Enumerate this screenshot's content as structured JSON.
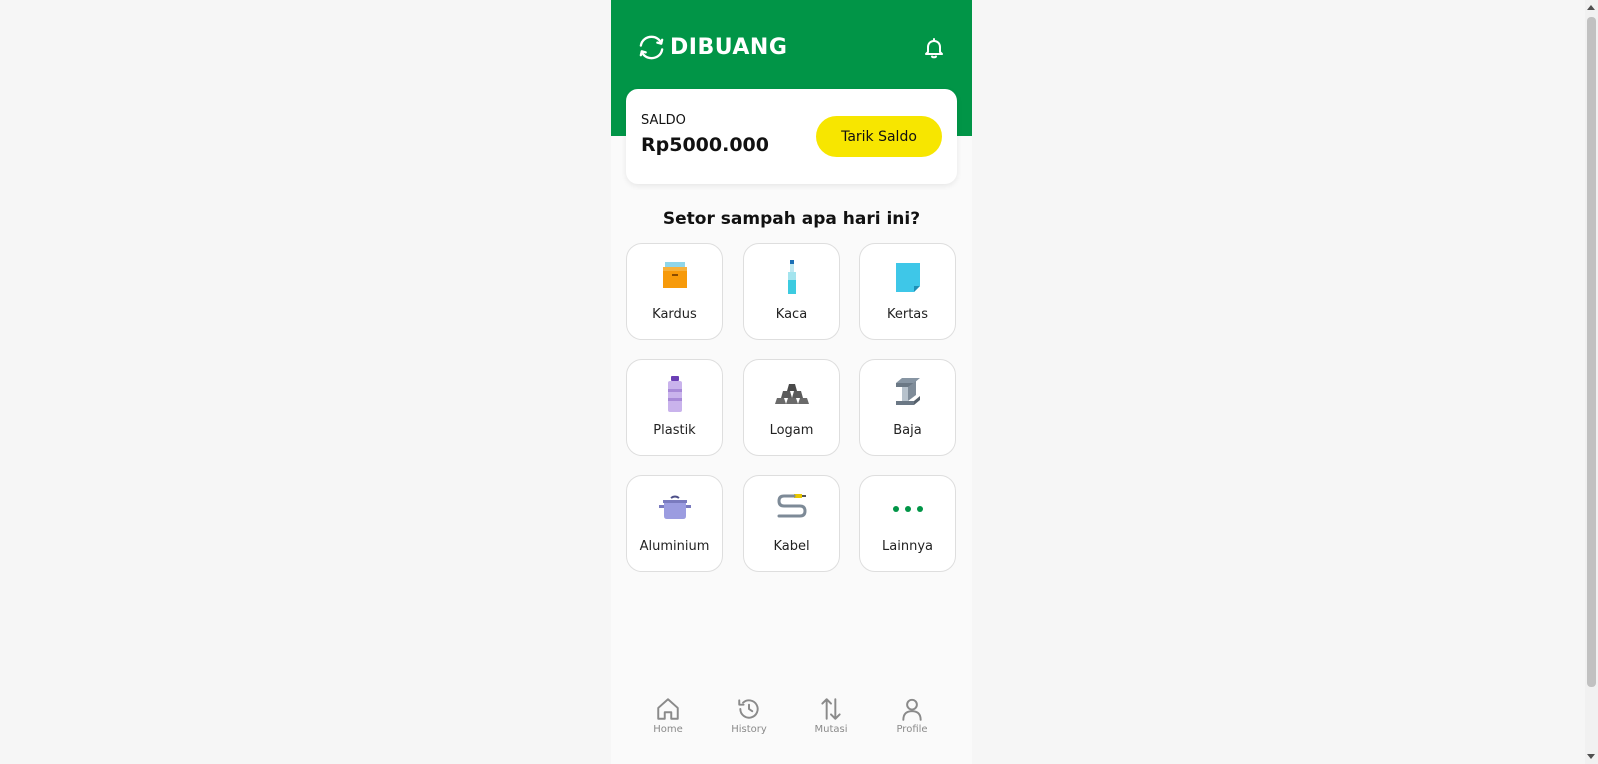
{
  "brand": {
    "name": "DIBUANG",
    "color": "#019547"
  },
  "balance": {
    "label": "SALDO",
    "amount": "Rp5000.000",
    "withdraw_label": "Tarik Saldo",
    "button_color": "#f7e600"
  },
  "deposit": {
    "title": "Setor sampah apa hari ini?",
    "categories": [
      {
        "label": "Kardus",
        "icon": "cardboard-box-icon"
      },
      {
        "label": "Kaca",
        "icon": "glass-bottle-icon"
      },
      {
        "label": "Kertas",
        "icon": "paper-icon"
      },
      {
        "label": "Plastik",
        "icon": "plastic-bottle-icon"
      },
      {
        "label": "Logam",
        "icon": "metal-bars-icon"
      },
      {
        "label": "Baja",
        "icon": "steel-beam-icon"
      },
      {
        "label": "Aluminium",
        "icon": "aluminium-pot-icon"
      },
      {
        "label": "Kabel",
        "icon": "cable-icon"
      },
      {
        "label": "Lainnya",
        "icon": "more-dots-icon"
      }
    ]
  },
  "nav": {
    "items": [
      {
        "label": "Home",
        "icon": "home-icon"
      },
      {
        "label": "History",
        "icon": "history-icon"
      },
      {
        "label": "Mutasi",
        "icon": "transfer-arrows-icon"
      },
      {
        "label": "Profile",
        "icon": "profile-icon"
      }
    ]
  }
}
